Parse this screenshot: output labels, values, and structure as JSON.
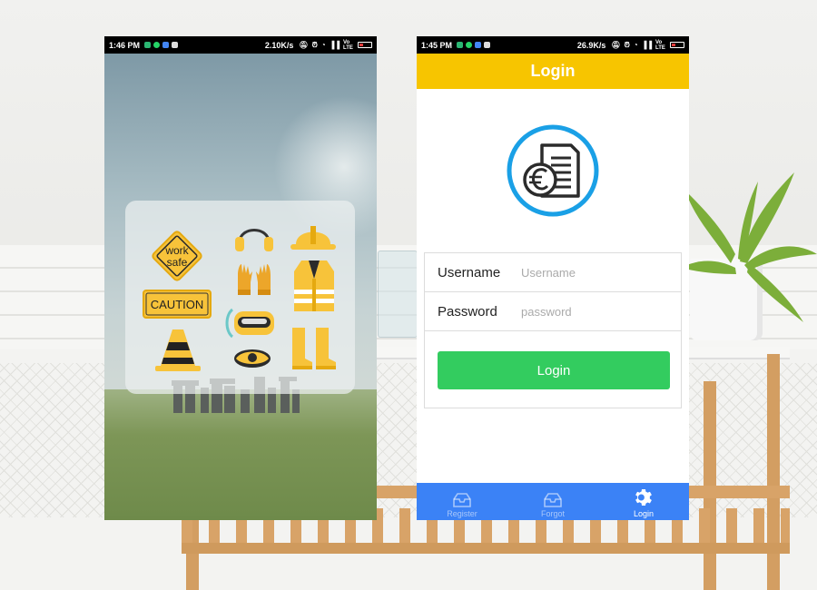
{
  "colors": {
    "title_bar": "#f7c500",
    "login_button": "#33cc5f",
    "tab_bar": "#3b82f6",
    "logo_ring": "#1aa0e6",
    "status_bar": "#000000"
  },
  "left_phone": {
    "status_bar": {
      "time": "1:46 PM",
      "speed": "2.10K/s",
      "network": "Vo LTE"
    },
    "icons": [
      "work-safe-sign",
      "caution-sign",
      "traffic-cone",
      "ear-muffs",
      "gloves",
      "safety-goggles",
      "respirator-mask",
      "hard-hat",
      "safety-vest",
      "rubber-boots"
    ],
    "sign": {
      "line1": "work",
      "line2": "safe",
      "caution": "CAUTION"
    }
  },
  "right_phone": {
    "status_bar": {
      "time": "1:45 PM",
      "speed": "26.9K/s",
      "network": "Vo LTE"
    },
    "title": "Login",
    "logo_icon": "euro-document-icon",
    "form": {
      "username_label": "Username",
      "username_placeholder": "Username",
      "password_label": "Password",
      "password_placeholder": "password",
      "login_button": "Login"
    },
    "tabs": [
      {
        "label": "Register",
        "icon": "inbox-icon",
        "active": false
      },
      {
        "label": "Forgot",
        "icon": "inbox-icon",
        "active": false
      },
      {
        "label": "Login",
        "icon": "gear-icon",
        "active": true
      }
    ]
  }
}
